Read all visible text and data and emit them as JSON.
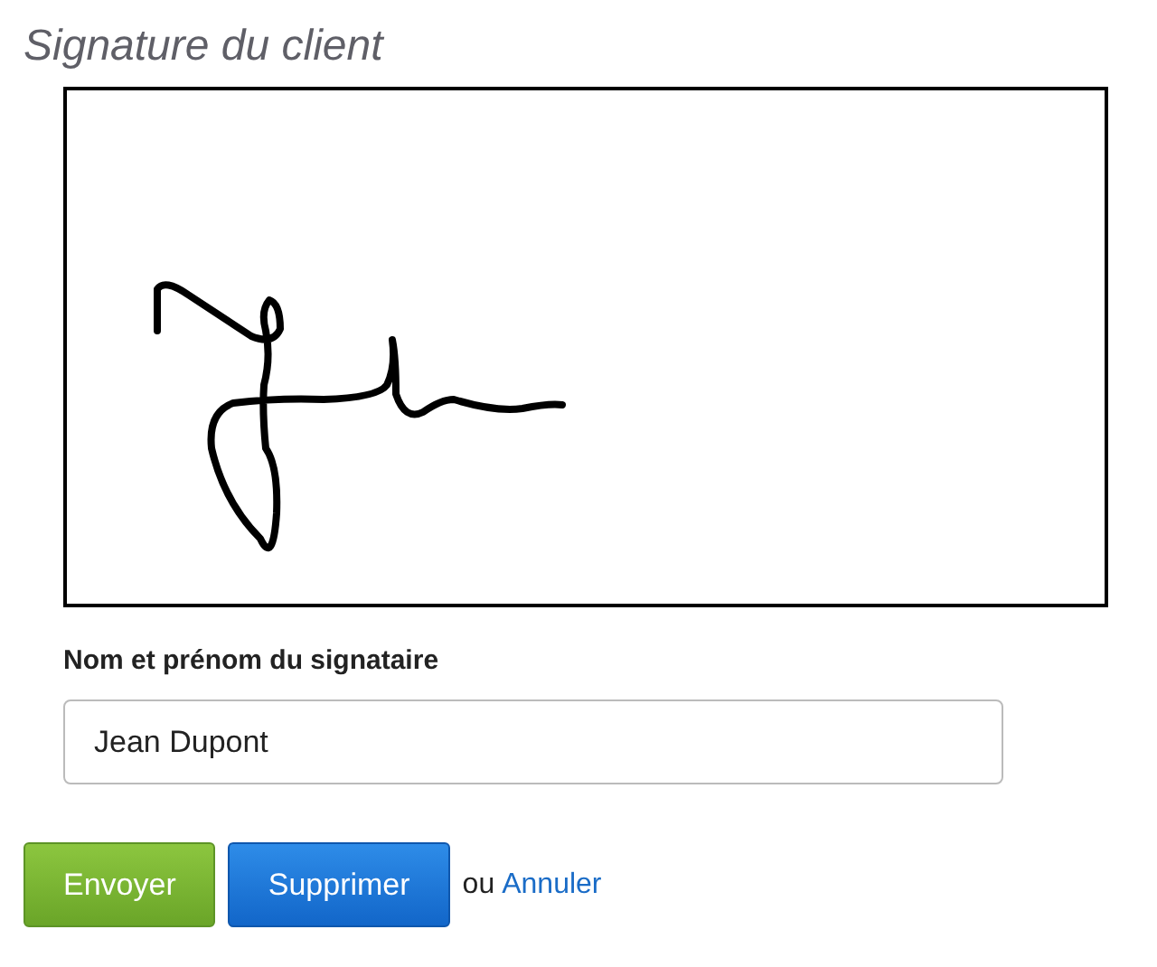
{
  "title": "Signature du client",
  "signature_pad": {
    "signed": true
  },
  "name_field": {
    "label": "Nom et prénom du signataire",
    "value": "Jean Dupont"
  },
  "buttons": [
    {
      "label": "Envoyer",
      "kind": "primary"
    },
    {
      "label": "Supprimer",
      "kind": "secondary"
    }
  ],
  "separator": "ou",
  "cancel_link": "Annuler"
}
